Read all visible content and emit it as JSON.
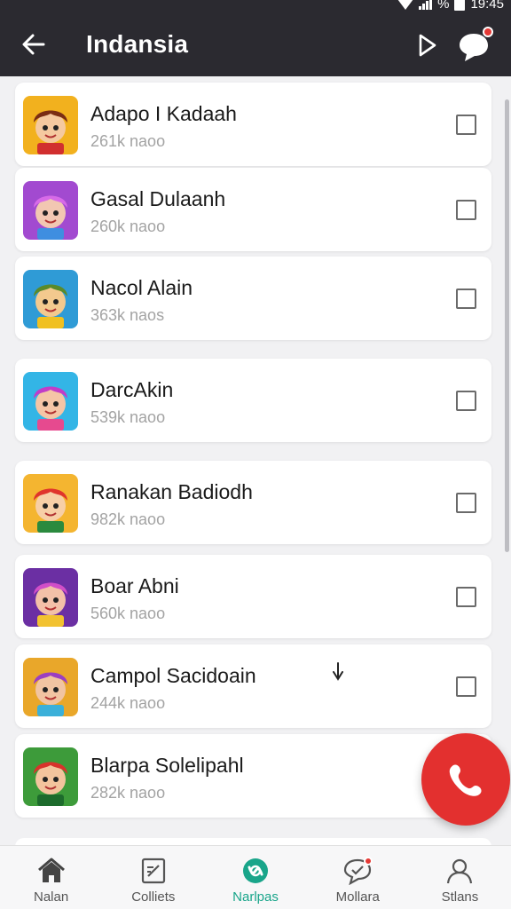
{
  "status_bar": {
    "time": "19:45",
    "battery_text": "%"
  },
  "app_bar": {
    "title": "Indansia"
  },
  "items": [
    {
      "title": "Adapo I Kadaah",
      "subtitle": "261k naoo",
      "avatar_bg": "#f2b11e",
      "hair": "#7a2d14",
      "skin": "#f5c9a0",
      "accent": "#d12f2f",
      "checked": false
    },
    {
      "title": "Gasal Dulaanh",
      "subtitle": "260k naoo",
      "avatar_bg": "#a24ad0",
      "hair": "#d76ae8",
      "skin": "#f2c7b2",
      "accent": "#3f8ee0",
      "checked": false
    },
    {
      "title": "Nacol Alain",
      "subtitle": "363k naos",
      "avatar_bg": "#2f9bd6",
      "hair": "#5a8a2a",
      "skin": "#f3c98e",
      "accent": "#f0c020",
      "checked": false
    },
    {
      "title": "DarcAkin",
      "subtitle": "539k naoo",
      "avatar_bg": "#33b5e6",
      "hair": "#c23cc8",
      "skin": "#f5c5a6",
      "accent": "#e64a8f",
      "checked": false
    },
    {
      "title": "Ranakan Badiodh",
      "subtitle": "982k naoo",
      "avatar_bg": "#f4b530",
      "hair": "#e0342c",
      "skin": "#f7cfa7",
      "accent": "#2b8a3e",
      "checked": false
    },
    {
      "title": "Boar Abni",
      "subtitle": "560k naoo",
      "avatar_bg": "#6b2fa3",
      "hair": "#d14ec8",
      "skin": "#f3c1a8",
      "accent": "#f2c230",
      "checked": false
    },
    {
      "title": "Campol Sacidoain",
      "subtitle": "244k naoo",
      "avatar_bg": "#e9a72a",
      "hair": "#9b3fc2",
      "skin": "#f1c4a2",
      "accent": "#3bb0d9",
      "checked": false
    },
    {
      "title": "Blarpa  Solelipahl",
      "subtitle": "282k naoo",
      "avatar_bg": "#3d9b3a",
      "hair": "#d8332b",
      "skin": "#f3c49d",
      "accent": "#1d6b2c",
      "checked": false
    }
  ],
  "nav": [
    {
      "label": "Nalan",
      "icon": "home-icon",
      "active": false
    },
    {
      "label": "Colliets",
      "icon": "edit-note-icon",
      "active": false
    },
    {
      "label": "Narlpas",
      "icon": "games-icon",
      "active": true
    },
    {
      "label": "Mollara",
      "icon": "notification-chat-icon",
      "active": false
    },
    {
      "label": "Stlans",
      "icon": "profile-icon",
      "active": false
    }
  ],
  "colors": {
    "app_bar": "#2b2a30",
    "fab": "#e3302f",
    "active_nav": "#19a58a",
    "badge": "#e53935"
  }
}
